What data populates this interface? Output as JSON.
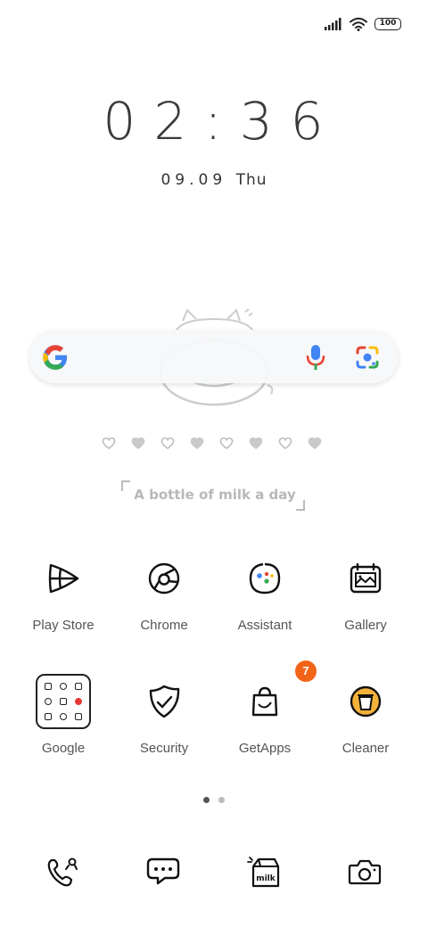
{
  "status_bar": {
    "battery": "100",
    "signal_icon": "signal-bars-icon",
    "wifi_icon": "wifi-icon"
  },
  "lockscreen_widget": {
    "time": "02:36",
    "date": "09.09",
    "weekday": "Thu"
  },
  "search_widget": {
    "logo_icon": "google-g-icon",
    "mic_icon": "microphone-icon",
    "lens_icon": "google-lens-icon"
  },
  "decor": {
    "slogan": "A bottle of milk a day",
    "hearts": [
      "outline",
      "filled",
      "outline",
      "filled",
      "outline",
      "filled",
      "outline",
      "filled"
    ]
  },
  "apps": [
    {
      "label": "Play Store",
      "icon": "play-store-icon"
    },
    {
      "label": "Chrome",
      "icon": "chrome-icon"
    },
    {
      "label": "Assistant",
      "icon": "assistant-icon"
    },
    {
      "label": "Gallery",
      "icon": "gallery-icon"
    },
    {
      "label": "Google",
      "icon": "google-folder-icon"
    },
    {
      "label": "Security",
      "icon": "security-shield-icon"
    },
    {
      "label": "GetApps",
      "icon": "getapps-bag-icon",
      "badge": "7"
    },
    {
      "label": "Cleaner",
      "icon": "cleaner-bin-icon"
    }
  ],
  "pager": {
    "pages": 2,
    "current": 1,
    "active_color": "#555555",
    "inactive_color": "#bbbbbb"
  },
  "dock": [
    {
      "icon": "phone-icon"
    },
    {
      "icon": "messages-icon"
    },
    {
      "icon": "milk-carton-icon",
      "text": "milk"
    },
    {
      "icon": "camera-icon"
    }
  ],
  "colors": {
    "badge": "#f26418",
    "cleaner_yellow": "#f3b23a"
  }
}
